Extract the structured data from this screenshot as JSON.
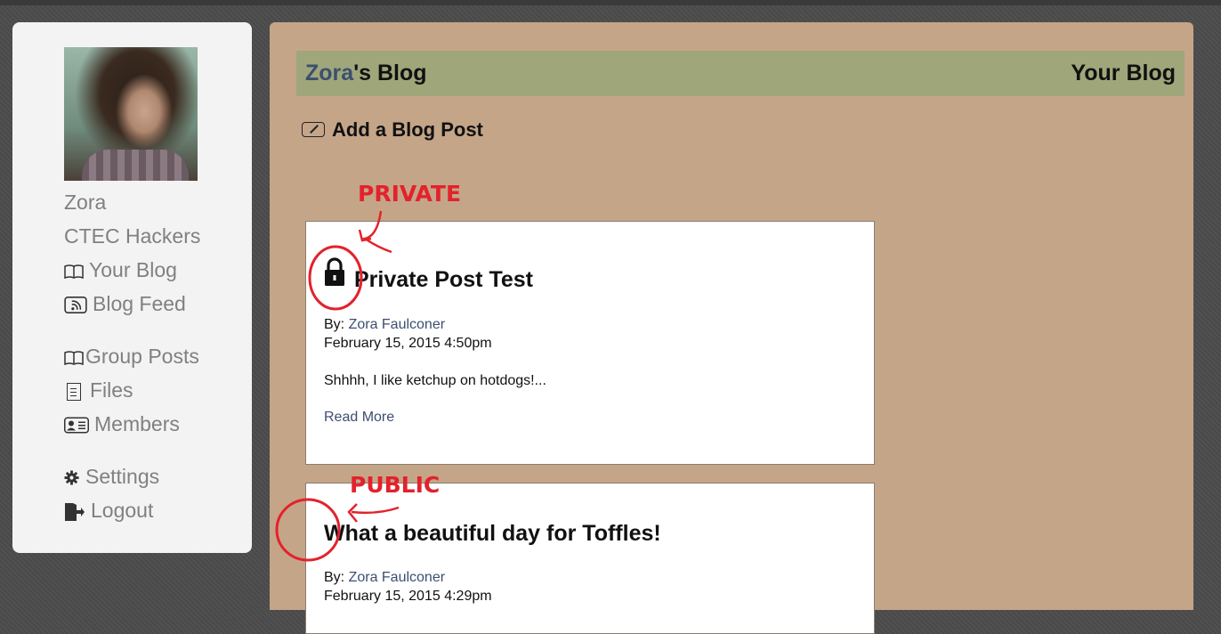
{
  "sidebar": {
    "username": "Zora",
    "group": "CTEC Hackers",
    "items": [
      {
        "label": "Your Blog",
        "icon": "book-icon"
      },
      {
        "label": "Blog Feed",
        "icon": "rss-icon"
      },
      {
        "label": "Group Posts",
        "icon": "book-icon"
      },
      {
        "label": "Files",
        "icon": "file-icon"
      },
      {
        "label": "Members",
        "icon": "contact-card-icon"
      },
      {
        "label": "Settings",
        "icon": "gear-icon"
      },
      {
        "label": "Logout",
        "icon": "logout-icon"
      }
    ]
  },
  "header": {
    "owner": "Zora",
    "suffix": "'s Blog",
    "right": "Your Blog"
  },
  "add_post_label": "Add a Blog Post",
  "posts": [
    {
      "title": "Private Post Test",
      "by_label": "By: ",
      "author": "Zora Faulconer",
      "date": "February 15, 2015 4:50pm",
      "excerpt": "Shhhh, I like ketchup on hotdogs!...",
      "read_more": "Read More",
      "locked": true
    },
    {
      "title": "What a beautiful day for Toffles!",
      "by_label": "By: ",
      "author": "Zora Faulconer",
      "date": "February 15, 2015 4:29pm",
      "locked": false
    }
  ],
  "annotations": {
    "private_label": "PRIVATE",
    "public_label": "PUBLIC"
  },
  "colors": {
    "annotation": "#e3222c",
    "link": "#3b4f70",
    "header_bar": "#9fa67a",
    "main_bg": "#c5a588"
  }
}
